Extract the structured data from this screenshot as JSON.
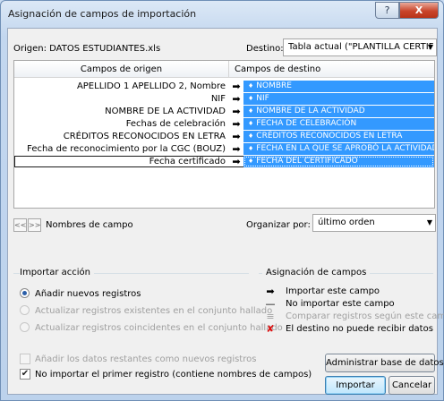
{
  "window": {
    "title": "Asignación de campos de importación",
    "help_button": "?",
    "close_button": "X"
  },
  "origin": {
    "text": "Origen: DATOS ESTUDIANTES.xls"
  },
  "destination": {
    "label": "Destino:",
    "value": "Tabla actual (\"PLANTILLA CERTIF"
  },
  "grid": {
    "header_source": "Campos de origen",
    "header_dest": "Campos de destino",
    "rows": [
      {
        "source": "APELLIDO 1 APELLIDO 2, Nombre",
        "dest": "NOMBRE"
      },
      {
        "source": "NIF",
        "dest": "NIF"
      },
      {
        "source": "NOMBRE DE LA ACTIVIDAD",
        "dest": "NOMBRE DE LA ACTIVIDAD"
      },
      {
        "source": "Fechas de celebración",
        "dest": "FECHA DE CELEBRACIÓN"
      },
      {
        "source": "CRÉDITOS RECONOCIDOS EN LETRA",
        "dest": "CRÉDITOS RECONOCIDOS EN LETRA"
      },
      {
        "source": "Fecha de reconocimiento por la CGC (BOUZ)",
        "dest": "FECHA EN LA QUE SE APROBÓ LA ACTIVIDAD"
      },
      {
        "source": "Fecha certificado",
        "dest": "FECHA DEL CERTIFICADO"
      }
    ],
    "selected_row": 6
  },
  "nav": {
    "prev": "<<",
    "next": ">>",
    "label": "Nombres de campo"
  },
  "organize": {
    "label": "Organizar por:",
    "value": "último orden"
  },
  "import_action": {
    "title": "Importar acción",
    "options": [
      {
        "label": "Añadir nuevos registros",
        "selected": true,
        "enabled": true
      },
      {
        "label": "Actualizar registros existentes en el conjunto hallado",
        "selected": false,
        "enabled": false
      },
      {
        "label": "Actualizar registros coincidentes en el conjunto hallado",
        "selected": false,
        "enabled": false
      }
    ]
  },
  "mapping_legend": {
    "title": "Asignación de campos",
    "items": [
      {
        "icon": "import-arrow-icon",
        "glyph": "➡",
        "label": "Importar este campo",
        "enabled": true
      },
      {
        "icon": "dash-icon",
        "glyph": "—",
        "label": "No importar este campo",
        "enabled": true
      },
      {
        "icon": "equals-icon",
        "glyph": "≡",
        "label": "Comparar registros según este campo",
        "enabled": false
      },
      {
        "icon": "red-x-icon",
        "glyph": "✘",
        "label": "El destino no puede recibir datos",
        "enabled": true
      }
    ]
  },
  "checks": {
    "add_remaining": {
      "label": "Añadir los datos restantes como nuevos registros",
      "checked": false,
      "enabled": false
    },
    "skip_first": {
      "label": "No importar el primer registro (contiene nombres de campos)",
      "checked": true,
      "enabled": true
    }
  },
  "buttons": {
    "manage_db": "Administrar base de datos...",
    "import": "Importar",
    "cancel": "Cancelar"
  },
  "colors": {
    "selection_blue": "#3399ff",
    "default_button": "#bee6fd",
    "close_red": "#c9452b"
  }
}
